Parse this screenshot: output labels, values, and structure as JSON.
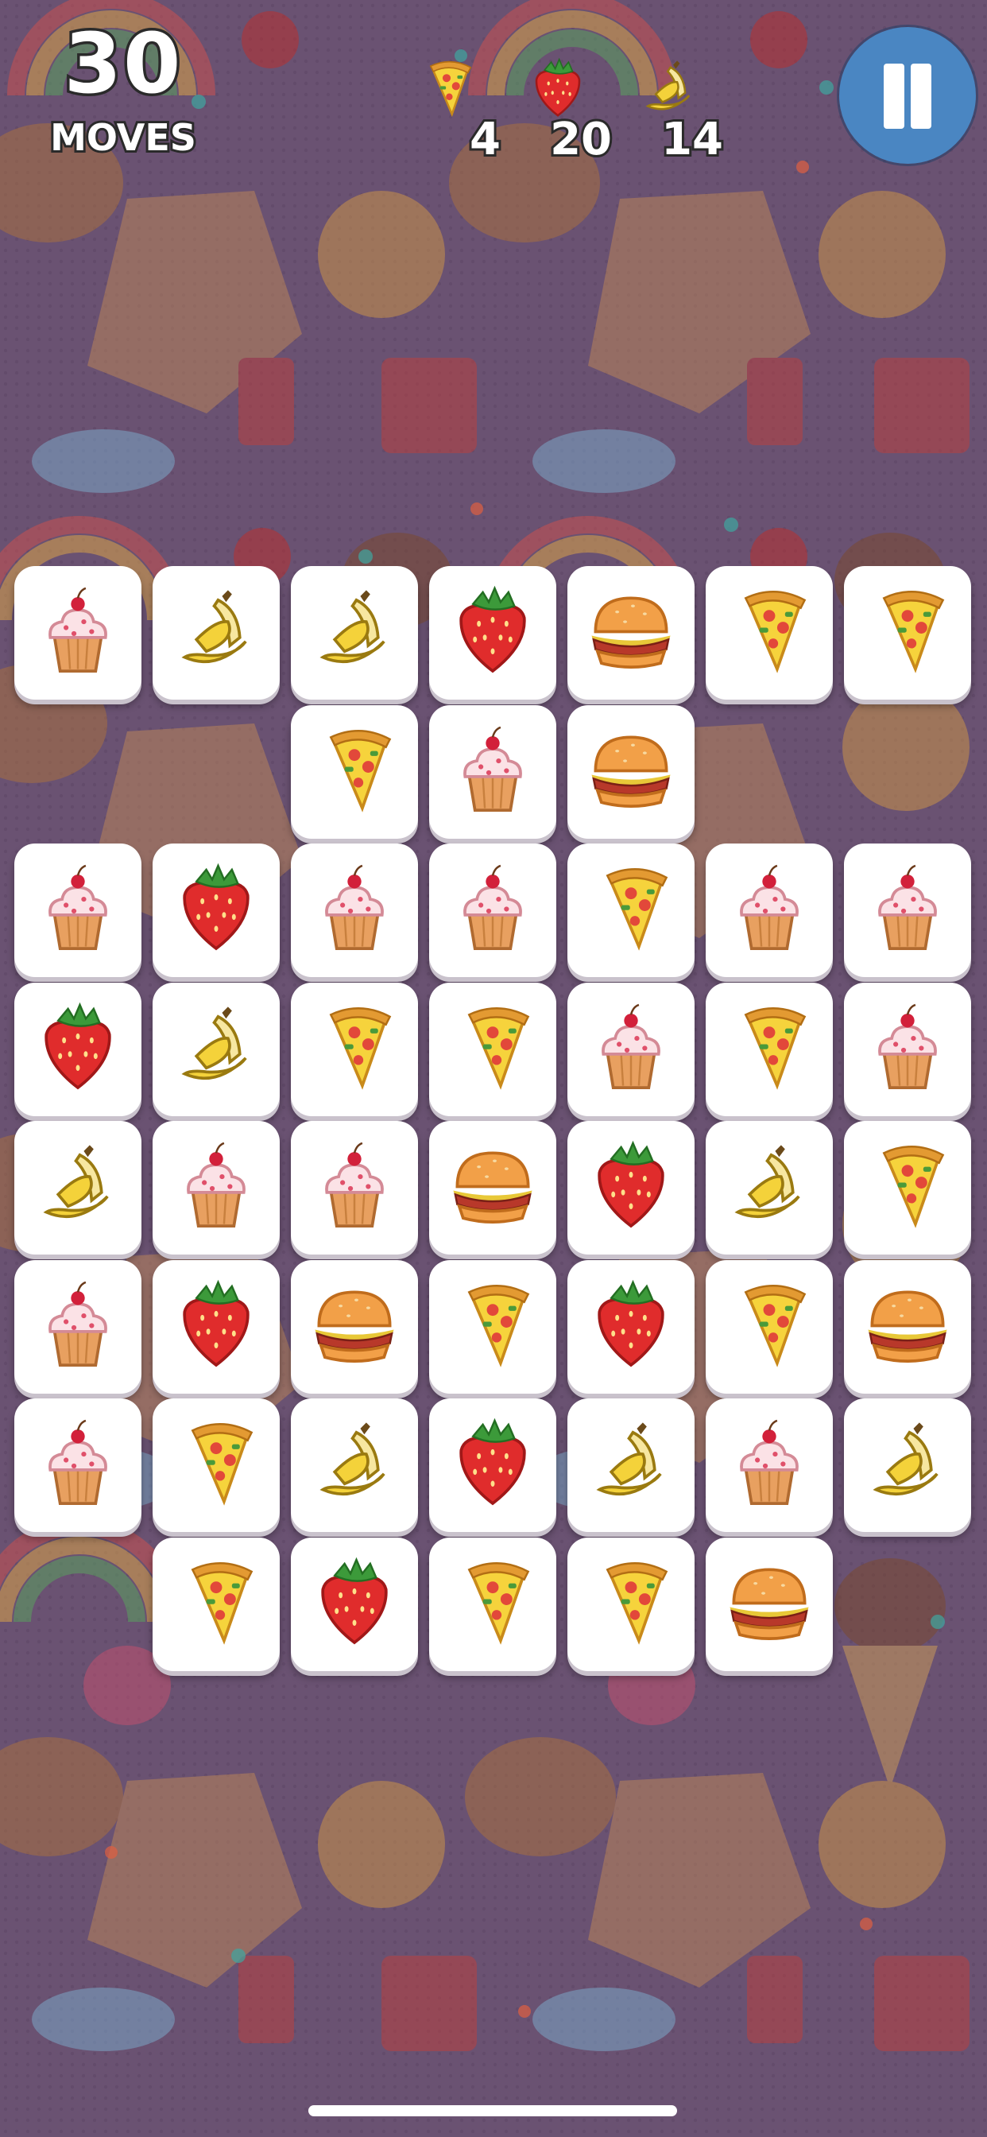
{
  "hud": {
    "moves_count": "30",
    "moves_label": "MOVES",
    "goals": [
      {
        "icon": "pizza-icon",
        "count": "4"
      },
      {
        "icon": "strawberry-icon",
        "count": "20"
      },
      {
        "icon": "banana-icon",
        "count": "14"
      }
    ],
    "pause_icon": "pause-icon",
    "pause_color": "#4a86c2"
  },
  "board": {
    "columns": 7,
    "rows": [
      [
        "cupcake",
        "banana",
        "banana",
        "strawberry",
        "burger",
        "pizza",
        "pizza"
      ],
      [
        null,
        null,
        "pizza",
        "cupcake",
        "burger",
        null,
        null
      ],
      [
        "cupcake",
        "strawberry",
        "cupcake",
        "cupcake",
        "pizza",
        "cupcake",
        "cupcake"
      ],
      [
        "strawberry",
        "banana",
        "pizza",
        "pizza",
        "cupcake",
        "pizza",
        "cupcake"
      ],
      [
        "banana",
        "cupcake",
        "cupcake",
        "burger",
        "strawberry",
        "banana",
        "pizza"
      ],
      [
        "cupcake",
        "strawberry",
        "burger",
        "pizza",
        "strawberry",
        "pizza",
        "burger"
      ],
      [
        "cupcake",
        "pizza",
        "banana",
        "strawberry",
        "banana",
        "cupcake",
        "banana"
      ],
      [
        null,
        "pizza",
        "strawberry",
        "pizza",
        "pizza",
        "burger",
        null
      ]
    ]
  },
  "colors": {
    "background": "#6a5272",
    "tile": "#ffffff"
  }
}
